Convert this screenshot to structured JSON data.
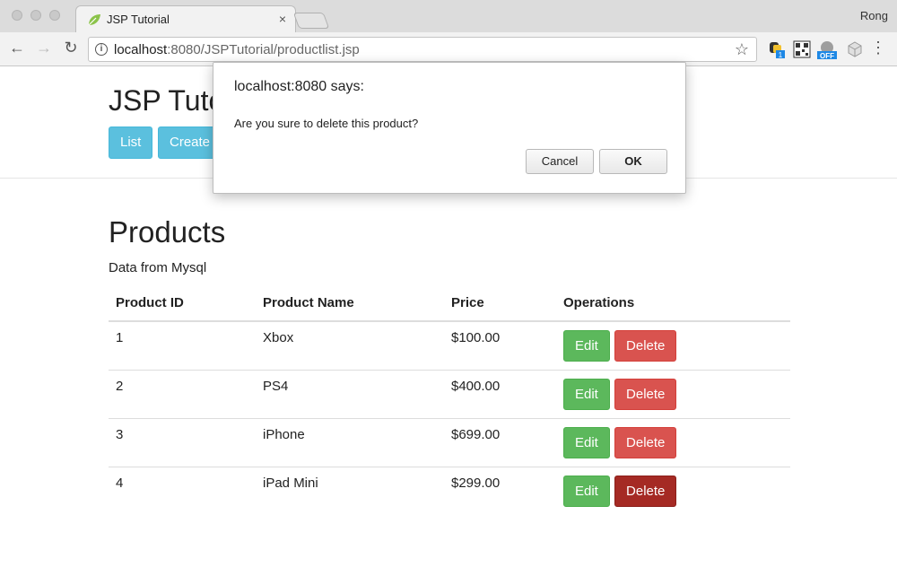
{
  "browser": {
    "tab_title": "JSP Tutorial",
    "tab_close": "×",
    "profile_name": "Rong",
    "url_host": "localhost",
    "url_rest": ":8080/JSPTutorial/productlist.jsp",
    "nav_back": "←",
    "nav_forward": "→",
    "nav_reload": "↻",
    "bookmark_star": "☆",
    "menu_dots": "⋮",
    "ext_badge_count": "1",
    "ext_off_label": "OFF"
  },
  "header": {
    "title": "JSP Tutorial",
    "list_button": "List",
    "create_button": "Create"
  },
  "products": {
    "title": "Products",
    "subtitle": "Data from Mysql",
    "columns": [
      "Product ID",
      "Product Name",
      "Price",
      "Operations"
    ],
    "rows": [
      {
        "id": "1",
        "name": "Xbox",
        "price": "$100.00"
      },
      {
        "id": "2",
        "name": "PS4",
        "price": "$400.00"
      },
      {
        "id": "3",
        "name": "iPhone",
        "price": "$699.00"
      },
      {
        "id": "4",
        "name": "iPad Mini",
        "price": "$299.00"
      }
    ],
    "edit_label": "Edit",
    "delete_label": "Delete"
  },
  "dialog": {
    "title": "localhost:8080 says:",
    "message": "Are you sure to delete this product?",
    "cancel_label": "Cancel",
    "ok_label": "OK"
  },
  "colors": {
    "info": "#5bc0de",
    "success": "#5cb85c",
    "danger": "#d9534f",
    "danger_active": "#a52a24"
  }
}
